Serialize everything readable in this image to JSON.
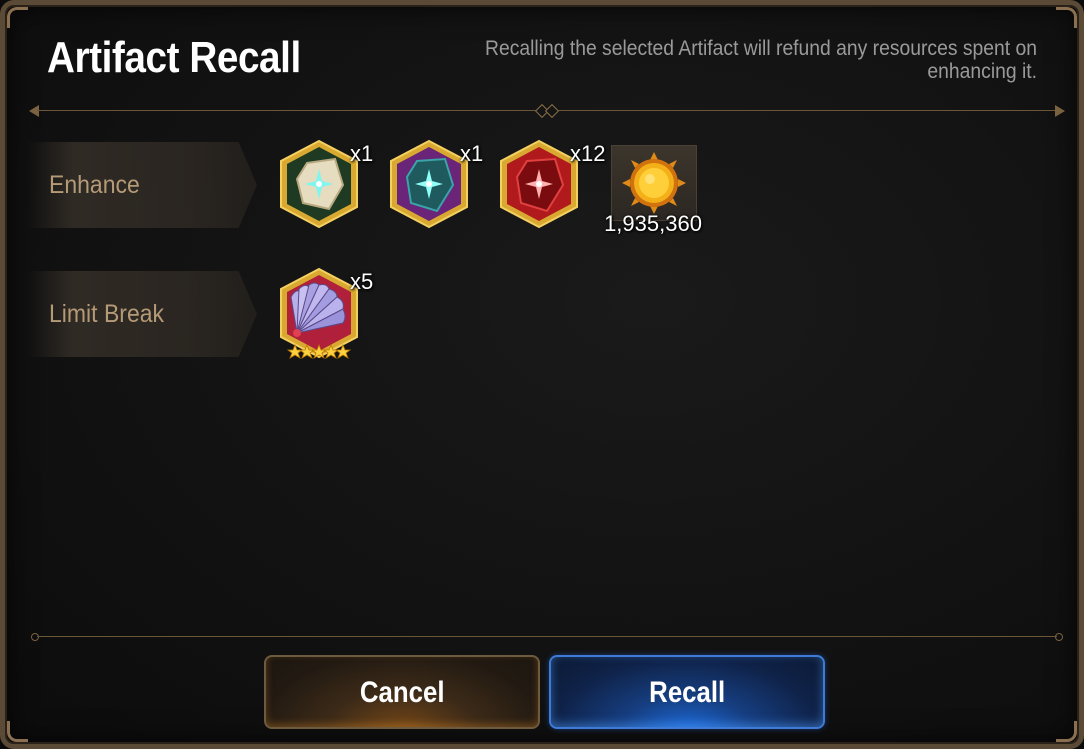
{
  "dialog": {
    "title": "Artifact Recall",
    "description": "Recalling the selected Artifact will refund any resources spent on enhancing it."
  },
  "rows": {
    "enhance": {
      "label": "Enhance",
      "items": [
        {
          "name": "white-fragment-icon",
          "count": "x1"
        },
        {
          "name": "teal-fragment-icon",
          "count": "x1"
        },
        {
          "name": "red-fragment-icon",
          "count": "x12"
        }
      ],
      "gold": {
        "icon": "gold-coin-icon",
        "amount": "1,935,360"
      }
    },
    "limit_break": {
      "label": "Limit Break",
      "items": [
        {
          "name": "fan-artifact-icon",
          "count": "x5",
          "stars": 5
        }
      ]
    }
  },
  "buttons": {
    "cancel": "Cancel",
    "recall": "Recall"
  },
  "colors": {
    "frame": "#5a4a36",
    "label_text": "#b59a77",
    "description_text": "#9a9a9a",
    "cancel_accent": "#6e5a3e",
    "recall_accent": "#3e7ad8"
  }
}
